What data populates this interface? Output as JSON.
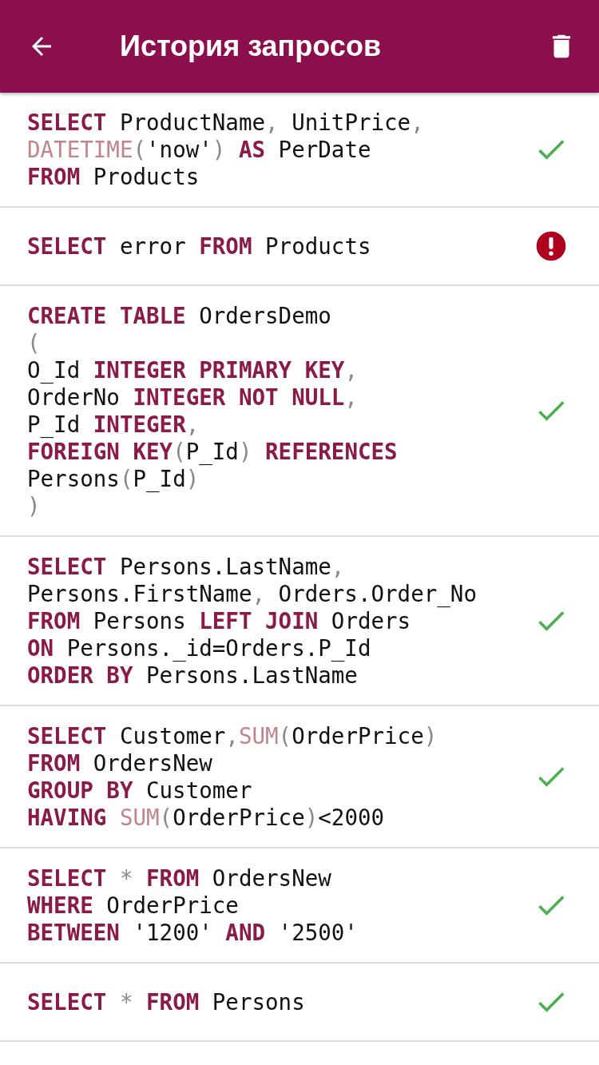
{
  "app_bar": {
    "title": "История запросов"
  },
  "queries": [
    {
      "kind": "success",
      "lines": [
        [
          {
            "kind": "keyword",
            "text": "SELECT"
          },
          {
            "kind": "plain",
            "text": " ProductName"
          },
          {
            "kind": "punct",
            "text": ","
          },
          {
            "kind": "plain",
            "text": " UnitPrice"
          },
          {
            "kind": "punct",
            "text": ","
          }
        ],
        [
          {
            "kind": "function",
            "text": "DATETIME"
          },
          {
            "kind": "punct",
            "text": "("
          },
          {
            "kind": "plain",
            "text": "'now'"
          },
          {
            "kind": "punct",
            "text": ")"
          },
          {
            "kind": "keyword",
            "text": " AS"
          },
          {
            "kind": "plain",
            "text": " PerDate"
          }
        ],
        [
          {
            "kind": "keyword",
            "text": "FROM"
          },
          {
            "kind": "plain",
            "text": " Products"
          }
        ]
      ]
    },
    {
      "kind": "error",
      "lines": [
        [
          {
            "kind": "keyword",
            "text": "SELECT"
          },
          {
            "kind": "plain",
            "text": " error "
          },
          {
            "kind": "keyword",
            "text": "FROM"
          },
          {
            "kind": "plain",
            "text": " Products"
          }
        ]
      ]
    },
    {
      "kind": "success",
      "lines": [
        [
          {
            "kind": "keyword",
            "text": "CREATE TABLE"
          },
          {
            "kind": "plain",
            "text": " OrdersDemo"
          }
        ],
        [
          {
            "kind": "punct",
            "text": "("
          }
        ],
        [
          {
            "kind": "plain",
            "text": "O_Id "
          },
          {
            "kind": "keyword",
            "text": "INTEGER PRIMARY KEY"
          },
          {
            "kind": "punct",
            "text": ","
          }
        ],
        [
          {
            "kind": "plain",
            "text": "OrderNo "
          },
          {
            "kind": "keyword",
            "text": "INTEGER NOT NULL"
          },
          {
            "kind": "punct",
            "text": ","
          }
        ],
        [
          {
            "kind": "plain",
            "text": "P_Id "
          },
          {
            "kind": "keyword",
            "text": "INTEGER"
          },
          {
            "kind": "punct",
            "text": ","
          }
        ],
        [
          {
            "kind": "keyword",
            "text": "FOREIGN KEY"
          },
          {
            "kind": "punct",
            "text": "("
          },
          {
            "kind": "plain",
            "text": "P_Id"
          },
          {
            "kind": "punct",
            "text": ")"
          },
          {
            "kind": "keyword",
            "text": " REFERENCES"
          }
        ],
        [
          {
            "kind": "plain",
            "text": "Persons"
          },
          {
            "kind": "punct",
            "text": "("
          },
          {
            "kind": "plain",
            "text": "P_Id"
          },
          {
            "kind": "punct",
            "text": ")"
          }
        ],
        [
          {
            "kind": "punct",
            "text": ")"
          }
        ]
      ]
    },
    {
      "kind": "success",
      "lines": [
        [
          {
            "kind": "keyword",
            "text": "SELECT"
          },
          {
            "kind": "plain",
            "text": " Persons.LastName"
          },
          {
            "kind": "punct",
            "text": ","
          }
        ],
        [
          {
            "kind": "plain",
            "text": "Persons.FirstName"
          },
          {
            "kind": "punct",
            "text": ","
          },
          {
            "kind": "plain",
            "text": " Orders.Order_No"
          }
        ],
        [
          {
            "kind": "keyword",
            "text": "FROM"
          },
          {
            "kind": "plain",
            "text": " Persons "
          },
          {
            "kind": "keyword",
            "text": "LEFT JOIN"
          },
          {
            "kind": "plain",
            "text": " Orders"
          }
        ],
        [
          {
            "kind": "keyword",
            "text": "ON"
          },
          {
            "kind": "plain",
            "text": " Persons._id=Orders.P_Id"
          }
        ],
        [
          {
            "kind": "keyword",
            "text": "ORDER BY"
          },
          {
            "kind": "plain",
            "text": " Persons.LastName"
          }
        ]
      ]
    },
    {
      "kind": "success",
      "lines": [
        [
          {
            "kind": "keyword",
            "text": "SELECT"
          },
          {
            "kind": "plain",
            "text": " Customer"
          },
          {
            "kind": "punct",
            "text": ","
          },
          {
            "kind": "function",
            "text": "SUM"
          },
          {
            "kind": "punct",
            "text": "("
          },
          {
            "kind": "plain",
            "text": "OrderPrice"
          },
          {
            "kind": "punct",
            "text": ")"
          }
        ],
        [
          {
            "kind": "keyword",
            "text": "FROM"
          },
          {
            "kind": "plain",
            "text": " OrdersNew"
          }
        ],
        [
          {
            "kind": "keyword",
            "text": "GROUP BY"
          },
          {
            "kind": "plain",
            "text": " Customer"
          }
        ],
        [
          {
            "kind": "keyword",
            "text": "HAVING"
          },
          {
            "kind": "function",
            "text": " SUM"
          },
          {
            "kind": "punct",
            "text": "("
          },
          {
            "kind": "plain",
            "text": "OrderPrice"
          },
          {
            "kind": "punct",
            "text": ")"
          },
          {
            "kind": "plain",
            "text": "<2000"
          }
        ]
      ]
    },
    {
      "kind": "success",
      "lines": [
        [
          {
            "kind": "keyword",
            "text": "SELECT"
          },
          {
            "kind": "punct",
            "text": " * "
          },
          {
            "kind": "keyword",
            "text": "FROM"
          },
          {
            "kind": "plain",
            "text": " OrdersNew"
          }
        ],
        [
          {
            "kind": "keyword",
            "text": "WHERE"
          },
          {
            "kind": "plain",
            "text": " OrderPrice"
          }
        ],
        [
          {
            "kind": "keyword",
            "text": "BETWEEN"
          },
          {
            "kind": "plain",
            "text": " '1200' "
          },
          {
            "kind": "keyword",
            "text": "AND"
          },
          {
            "kind": "plain",
            "text": " '2500'"
          }
        ]
      ]
    },
    {
      "kind": "success",
      "lines": [
        [
          {
            "kind": "keyword",
            "text": "SELECT"
          },
          {
            "kind": "punct",
            "text": " * "
          },
          {
            "kind": "keyword",
            "text": "FROM"
          },
          {
            "kind": "plain",
            "text": " Persons"
          }
        ]
      ]
    }
  ]
}
